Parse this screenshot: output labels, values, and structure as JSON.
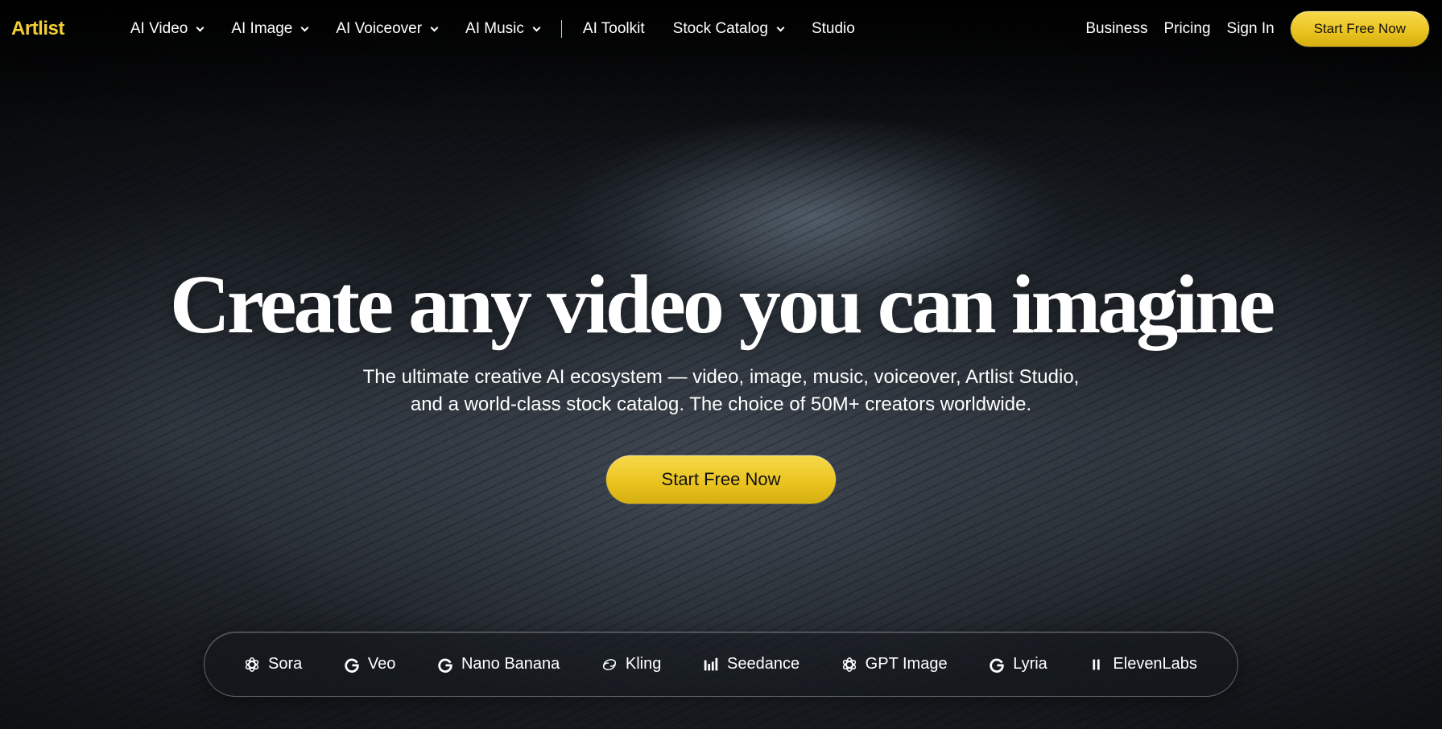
{
  "brand": {
    "name": "Artlist",
    "color": "#f2cf37"
  },
  "nav": {
    "items": [
      {
        "label": "AI Video",
        "dropdown": true
      },
      {
        "label": "AI Image",
        "dropdown": true
      },
      {
        "label": "AI Voiceover",
        "dropdown": true
      },
      {
        "label": "AI Music",
        "dropdown": true
      },
      {
        "label": "AI Toolkit",
        "dropdown": false
      },
      {
        "label": "Stock Catalog",
        "dropdown": true
      },
      {
        "label": "Studio",
        "dropdown": false
      }
    ],
    "right": {
      "business": "Business",
      "pricing": "Pricing",
      "sign_in": "Sign In",
      "cta": "Start Free Now"
    }
  },
  "hero": {
    "title": "Create any video you can imagine",
    "subtitle_line1": "The ultimate creative AI ecosystem — video, image, music, voiceover, Artlist Studio,",
    "subtitle_line2": "and a world-class stock catalog. The choice of 50M+ creators worldwide.",
    "cta": "Start Free Now"
  },
  "models": [
    {
      "label": "Sora",
      "icon": "openai-icon"
    },
    {
      "label": "Veo",
      "icon": "google-icon"
    },
    {
      "label": "Nano Banana",
      "icon": "google-icon"
    },
    {
      "label": "Kling",
      "icon": "kling-icon"
    },
    {
      "label": "Seedance",
      "icon": "bars-icon"
    },
    {
      "label": "GPT Image",
      "icon": "openai-icon"
    },
    {
      "label": "Lyria",
      "icon": "google-icon"
    },
    {
      "label": "ElevenLabs",
      "icon": "elevenlabs-icon"
    }
  ],
  "colors": {
    "accent": "#f2cf37",
    "cta_text": "#111111"
  }
}
